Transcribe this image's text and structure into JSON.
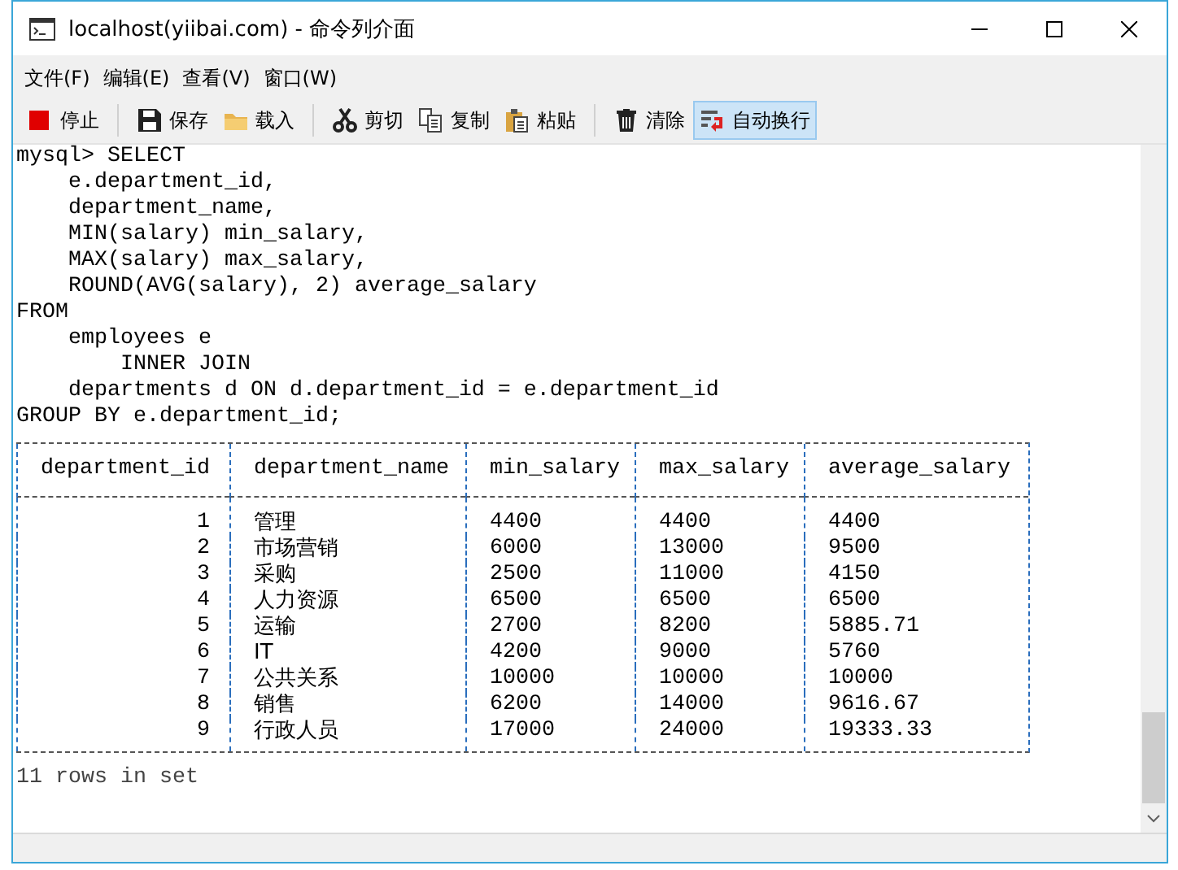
{
  "window": {
    "title": "localhost(yiibai.com) - 命令列介面"
  },
  "menu": [
    "文件(F)",
    "编辑(E)",
    "查看(V)",
    "窗口(W)"
  ],
  "toolbar": [
    {
      "kind": "stop",
      "label": "停止",
      "on": false
    },
    {
      "kind": "separator"
    },
    {
      "kind": "save",
      "label": "保存",
      "on": false
    },
    {
      "kind": "load",
      "label": "载入",
      "on": false
    },
    {
      "kind": "separator"
    },
    {
      "kind": "cut",
      "label": "剪切",
      "on": false
    },
    {
      "kind": "copy",
      "label": "复制",
      "on": false
    },
    {
      "kind": "paste",
      "label": "粘贴",
      "on": false
    },
    {
      "kind": "separator"
    },
    {
      "kind": "clear",
      "label": "清除",
      "on": false
    },
    {
      "kind": "wrap",
      "label": "自动换行",
      "on": true
    }
  ],
  "console": {
    "query_lines": [
      "mysql> SELECT",
      "    e.department_id,",
      "    department_name,",
      "    MIN(salary) min_salary,",
      "    MAX(salary) max_salary,",
      "    ROUND(AVG(salary), 2) average_salary",
      "FROM",
      "    employees e",
      "        INNER JOIN",
      "    departments d ON d.department_id = e.department_id",
      "GROUP BY e.department_id;"
    ],
    "result_table": {
      "columns": [
        "department_id",
        "department_name",
        "min_salary",
        "max_salary",
        "average_salary"
      ],
      "rows": [
        [
          "1",
          "管理",
          "4400",
          "4400",
          "4400"
        ],
        [
          "2",
          "市场营销",
          "6000",
          "13000",
          "9500"
        ],
        [
          "3",
          "采购",
          "2500",
          "11000",
          "4150"
        ],
        [
          "4",
          "人力资源",
          "6500",
          "6500",
          "6500"
        ],
        [
          "5",
          "运输",
          "2700",
          "8200",
          "5885.71"
        ],
        [
          "6",
          "IT",
          "4200",
          "9000",
          "5760"
        ],
        [
          "7",
          "公共关系",
          "10000",
          "10000",
          "10000"
        ],
        [
          "8",
          "销售",
          "6200",
          "14000",
          "9616.67"
        ],
        [
          "9",
          "行政人员",
          "17000",
          "24000",
          "19333.33"
        ]
      ]
    },
    "footer": "11 rows in set"
  }
}
